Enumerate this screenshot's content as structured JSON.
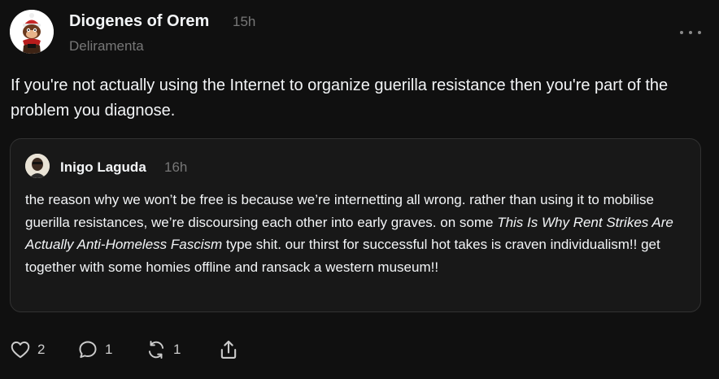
{
  "post": {
    "author": "Diogenes of Orem",
    "time": "15h",
    "handle": "Deliramenta",
    "text": "If you're not actually using the Internet to organize guerilla resistance then you're part of the problem you diagnose."
  },
  "quote": {
    "author": "Inigo Laguda",
    "time": "16h",
    "text_before": "the reason why we won’t be free is because we’re internetting all wrong. rather than using it to mobilise guerilla resistances, we’re discoursing each other into early graves. on some ",
    "text_italic": "This Is Why Rent Strikes Are Actually Anti-Homeless Fascism",
    "text_after": " type shit. our thirst for successful hot takes is craven individualism!! get together with some homies offline and ransack a western museum!!"
  },
  "actions": {
    "like_count": "2",
    "reply_count": "1",
    "repost_count": "1"
  },
  "icons": {
    "like": "heart-icon",
    "reply": "comment-icon",
    "repost": "repost-icon",
    "share": "share-icon",
    "more": "more-icon"
  },
  "colors": {
    "background": "#101010",
    "card": "#181818",
    "muted": "#777777",
    "text": "#f3f5f7"
  }
}
